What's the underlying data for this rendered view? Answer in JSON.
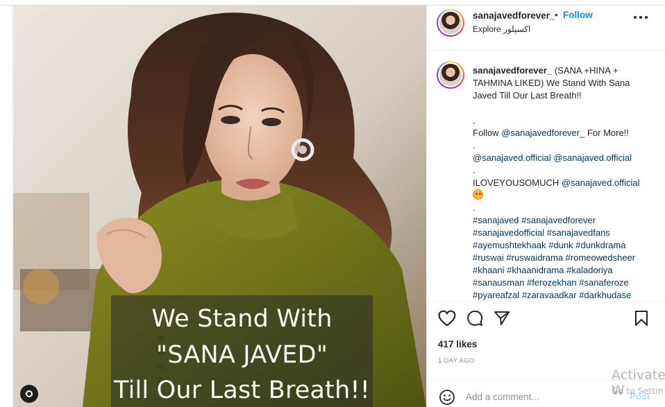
{
  "post": {
    "image_overlay": {
      "line1": "We Stand With",
      "line2": "\"SANA JAVED\"",
      "line3": "Till Our Last Breath!!"
    },
    "header": {
      "username": "sanajavedforever_",
      "separator": "•",
      "follow_label": "Follow",
      "location": "Explore اکسپلور"
    },
    "caption": {
      "username": "sanajavedforever_",
      "lines": [
        "(SANA +HINA +",
        "TAHMINA LIKED) We Stand With Sana",
        "Javed Till Our Last Breath!!",
        "",
        "."
      ],
      "follow_prefix": "Follow ",
      "follow_mention": "@sanajavedforever_",
      "follow_suffix": " For More!!",
      "dot2": ".",
      "mention_a": "@sanajaved.official",
      "mention_b": "@sanajaved.official",
      "dot3": ".",
      "love_text": "ILOVEYOUSOMUCH ",
      "love_mention": "@sanajaved.official",
      "dot4": ".",
      "hashtags": [
        "#sanajaved #sanajavedforever",
        "#sanajavedofficial #sanajavedfans",
        "#ayemushtekhaak #dunk #dunkdrama",
        "#ruswai #ruswaidrama #romeowedsheer",
        "#khaani #khaanidrama #kaladoriya",
        "#sanausman #ferozekhan #sanaferoze",
        "#pyareafzal #zaravaadkar #darkhudase"
      ]
    },
    "likes": "417 likes",
    "time": "1 DAY AGO",
    "comment_placeholder": "Add a comment...",
    "post_label": "Post"
  },
  "watermark": {
    "line1": "Activate W",
    "line2": "Go to Settin"
  },
  "colors": {
    "follow": "#0095f6",
    "link": "#00376b",
    "post_disabled": "#b2dffc",
    "muted": "#8e8e8e",
    "overlay_text": "#fbfbf2"
  },
  "icons": [
    "heart-icon",
    "comment-icon",
    "share-icon",
    "save-icon",
    "emoji-icon",
    "more-icon",
    "reels-icon"
  ]
}
